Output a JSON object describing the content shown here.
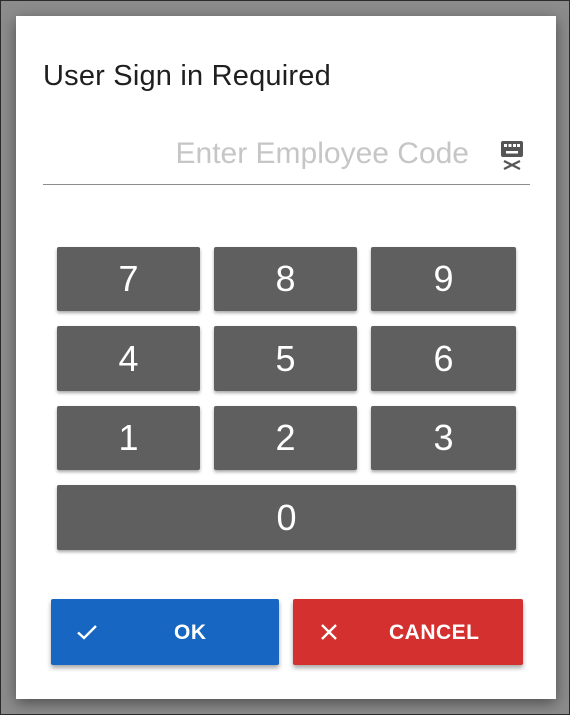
{
  "dialog": {
    "title": "User Sign in Required"
  },
  "code_field": {
    "value": "",
    "placeholder": "Enter Employee Code",
    "icon": "keyboard-close-icon"
  },
  "keypad": {
    "keys": [
      "7",
      "8",
      "9",
      "4",
      "5",
      "6",
      "1",
      "2",
      "3",
      "0"
    ]
  },
  "actions": {
    "ok_label": "OK",
    "ok_icon": "check-icon",
    "cancel_label": "CANCEL",
    "cancel_icon": "close-icon"
  },
  "colors": {
    "key_background": "#5f5f5f",
    "ok_background": "#1766c2",
    "cancel_background": "#d3302f"
  }
}
